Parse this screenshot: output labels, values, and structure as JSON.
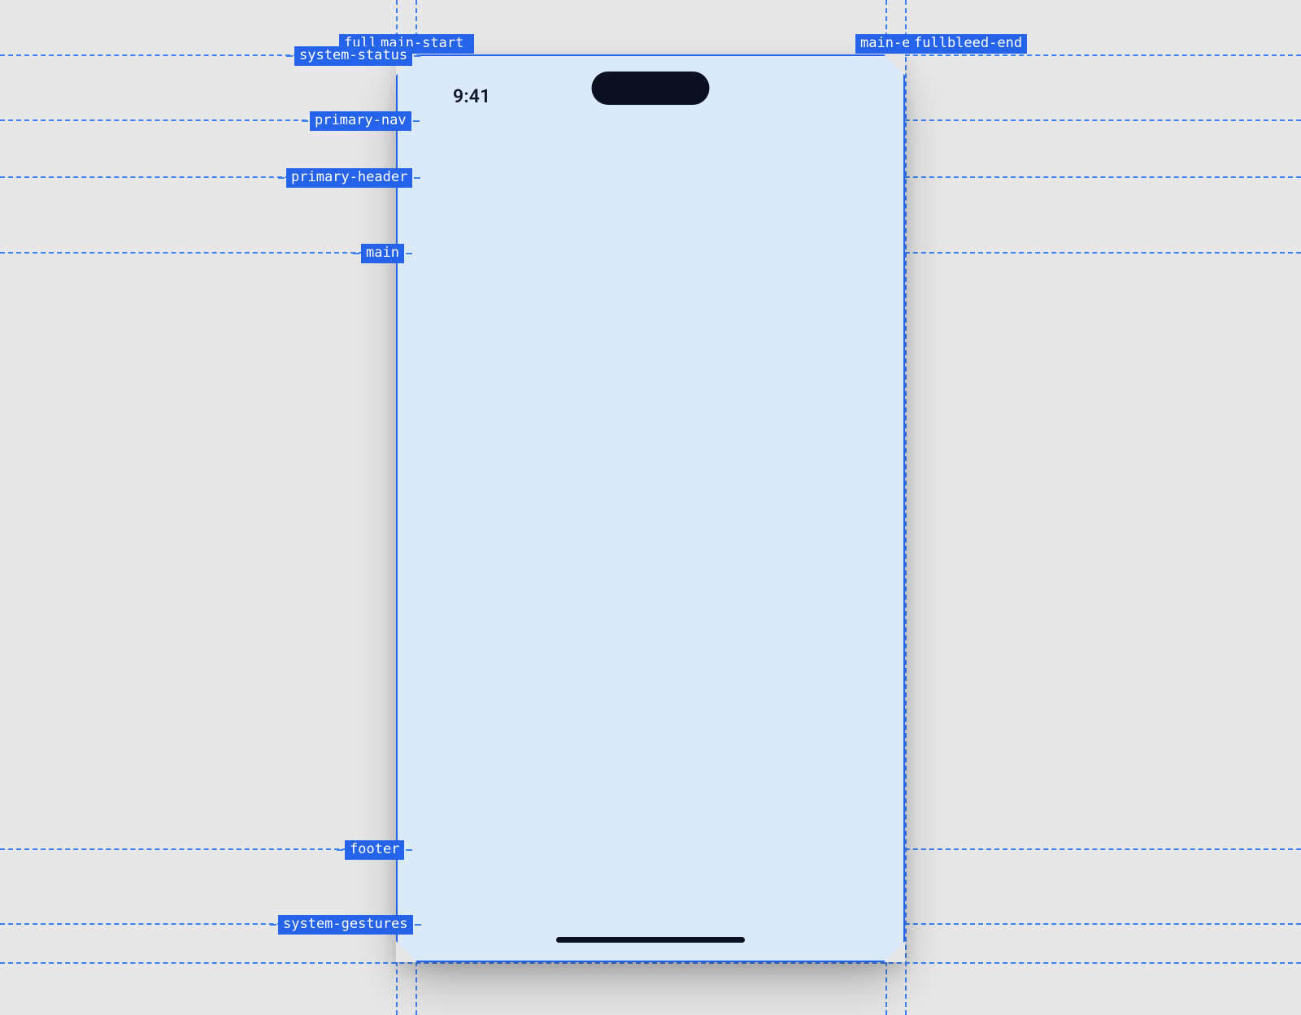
{
  "status": {
    "time": "9:41"
  },
  "guides": {
    "vertical": {
      "fullbleed_start": "fullbleed-start",
      "main_start": "main-start",
      "main_end": "main-end",
      "fullbleed_end": "fullbleed-end"
    },
    "horizontal": {
      "system_status": "system-status",
      "primary_nav": "primary-nav",
      "primary_header": "primary-header",
      "main": "main",
      "footer": "footer",
      "system_gestures": "system-gestures"
    }
  }
}
